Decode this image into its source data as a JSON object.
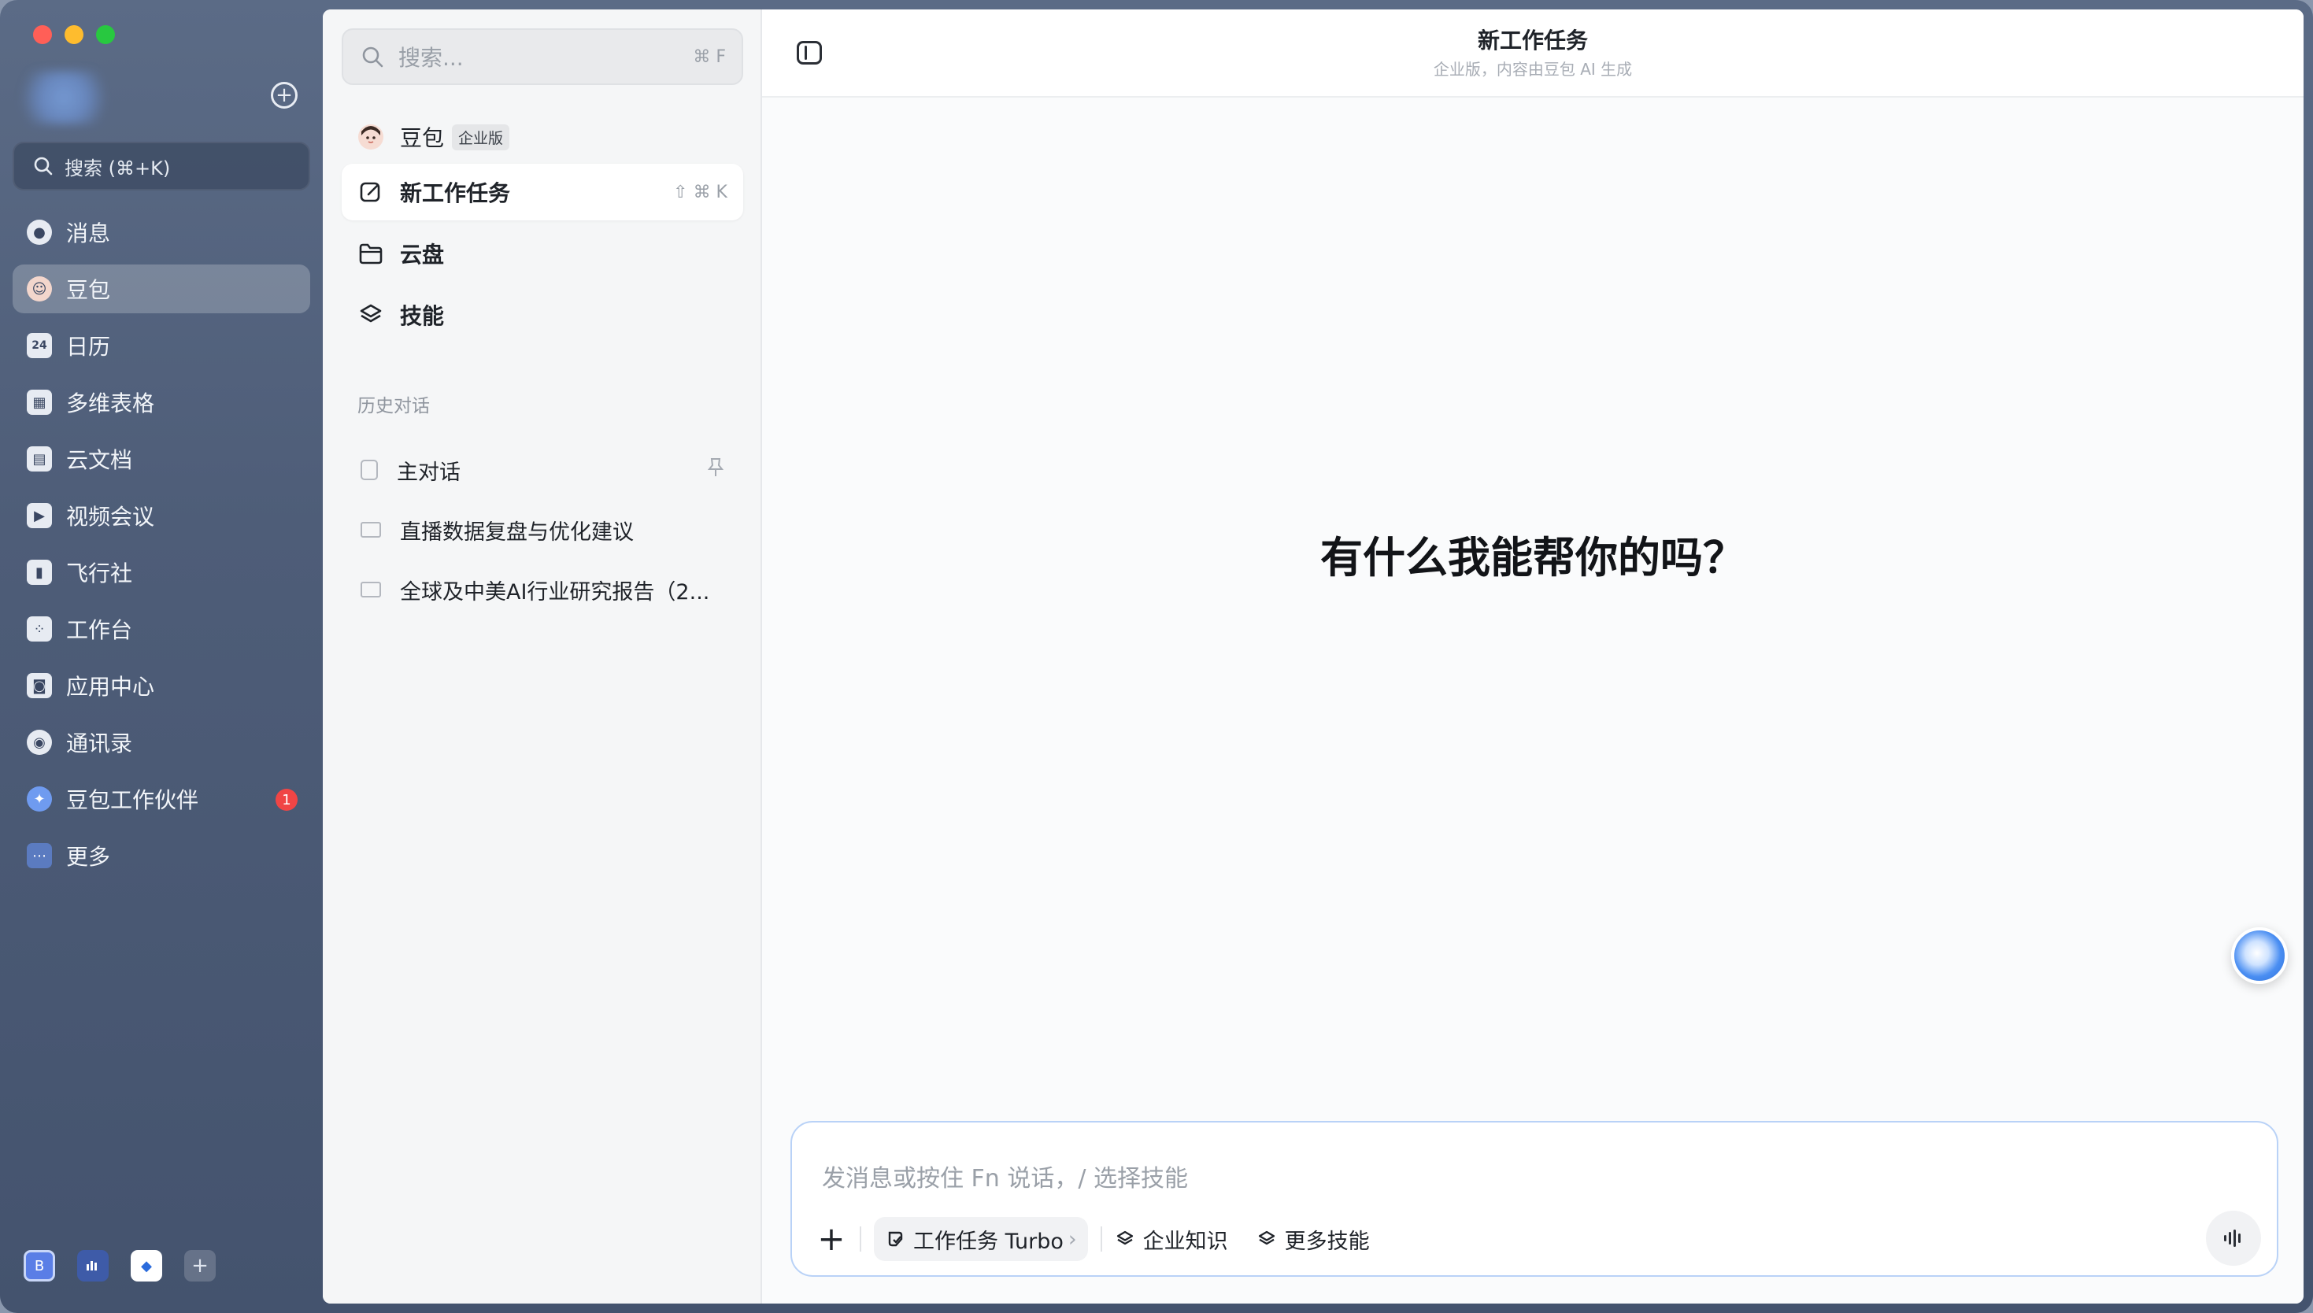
{
  "nav": {
    "search_label": "搜索 (⌘+K)",
    "items": [
      {
        "label": "消息",
        "icon": "chat-bubble-icon"
      },
      {
        "label": "豆包",
        "icon": "doubao-avatar-icon",
        "active": true
      },
      {
        "label": "日历",
        "icon": "calendar-icon",
        "icon_text": "24"
      },
      {
        "label": "多维表格",
        "icon": "table-icon"
      },
      {
        "label": "云文档",
        "icon": "cloud-doc-icon"
      },
      {
        "label": "视频会议",
        "icon": "video-icon"
      },
      {
        "label": "飞行社",
        "icon": "book-icon"
      },
      {
        "label": "工作台",
        "icon": "apps-grid-icon"
      },
      {
        "label": "应用中心",
        "icon": "bag-icon"
      },
      {
        "label": "通讯录",
        "icon": "contacts-icon"
      },
      {
        "label": "豆包工作伙伴",
        "icon": "partner-icon",
        "badge": "1"
      },
      {
        "label": "更多",
        "icon": "more-icon"
      }
    ],
    "dock": {
      "app_b_label": "B"
    }
  },
  "panel": {
    "search_placeholder": "搜索...",
    "search_shortcut": "⌘ F",
    "doubao_label": "豆包",
    "enterprise_tag": "企业版",
    "new_task_label": "新工作任务",
    "new_task_shortcut": "⇧ ⌘ K",
    "cloud_label": "云盘",
    "skills_label": "技能",
    "history_title": "历史对话",
    "history": [
      {
        "label": "主对话",
        "pinned": true
      },
      {
        "label": "直播数据复盘与优化建议"
      },
      {
        "label": "全球及中美AI行业研究报告（2..."
      }
    ]
  },
  "main": {
    "title": "新工作任务",
    "subtitle": "企业版，内容由豆包 AI 生成",
    "headline": "有什么我能帮你的吗？",
    "composer": {
      "placeholder": "发消息或按住 Fn 说话，/ 选择技能",
      "mode_label": "工作任务 Turbo",
      "knowledge_label": "企业知识",
      "more_skills_label": "更多技能"
    }
  },
  "colors": {
    "sidebar_bg": "#4e5d78",
    "accent": "#4a8ef2",
    "badge": "#f04545",
    "composer_border": "#b9d2f7"
  }
}
